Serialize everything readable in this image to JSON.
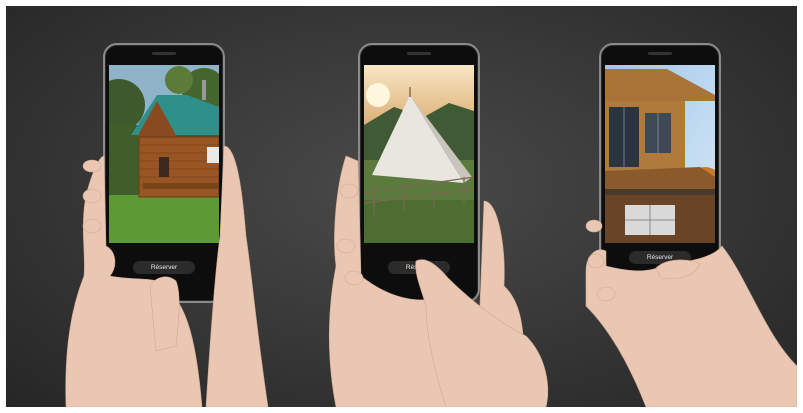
{
  "phones": [
    {
      "scene": "wooden-cabin",
      "button_label": "Réserver"
    },
    {
      "scene": "glamping-tent",
      "button_label": "Réserver"
    },
    {
      "scene": "modern-wood-house",
      "button_label": "Réserver"
    }
  ],
  "colors": {
    "background": "#3a3a3a",
    "skin": "#e9c7b2",
    "phone_body": "#0d0d0d",
    "button": "#2b2b2b"
  }
}
